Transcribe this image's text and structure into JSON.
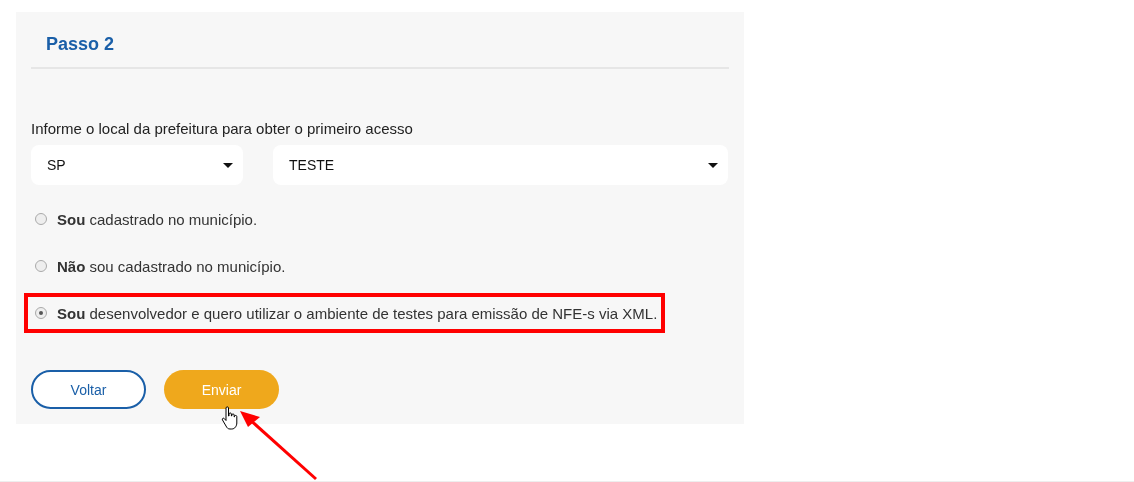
{
  "step_title": "Passo 2",
  "location_label": "Informe o local da prefeitura para obter o primeiro acesso",
  "selects": [
    {
      "value": "SP",
      "kind": "narrow"
    },
    {
      "value": "TESTE",
      "kind": "wide"
    }
  ],
  "options": [
    {
      "text": "**Sou** cadastrado no município.",
      "selected": false,
      "highlighted": false
    },
    {
      "text": "**Não** sou cadastrado no município.",
      "selected": false,
      "highlighted": false
    },
    {
      "text": "**Sou** desenvolvedor e quero utilizar o ambiente de testes para emissão de NFE-s via XML.",
      "selected": true,
      "highlighted": true
    }
  ],
  "buttons": [
    {
      "label": "Voltar",
      "kind": "outline"
    },
    {
      "label": "Enviar",
      "kind": "primary"
    }
  ]
}
